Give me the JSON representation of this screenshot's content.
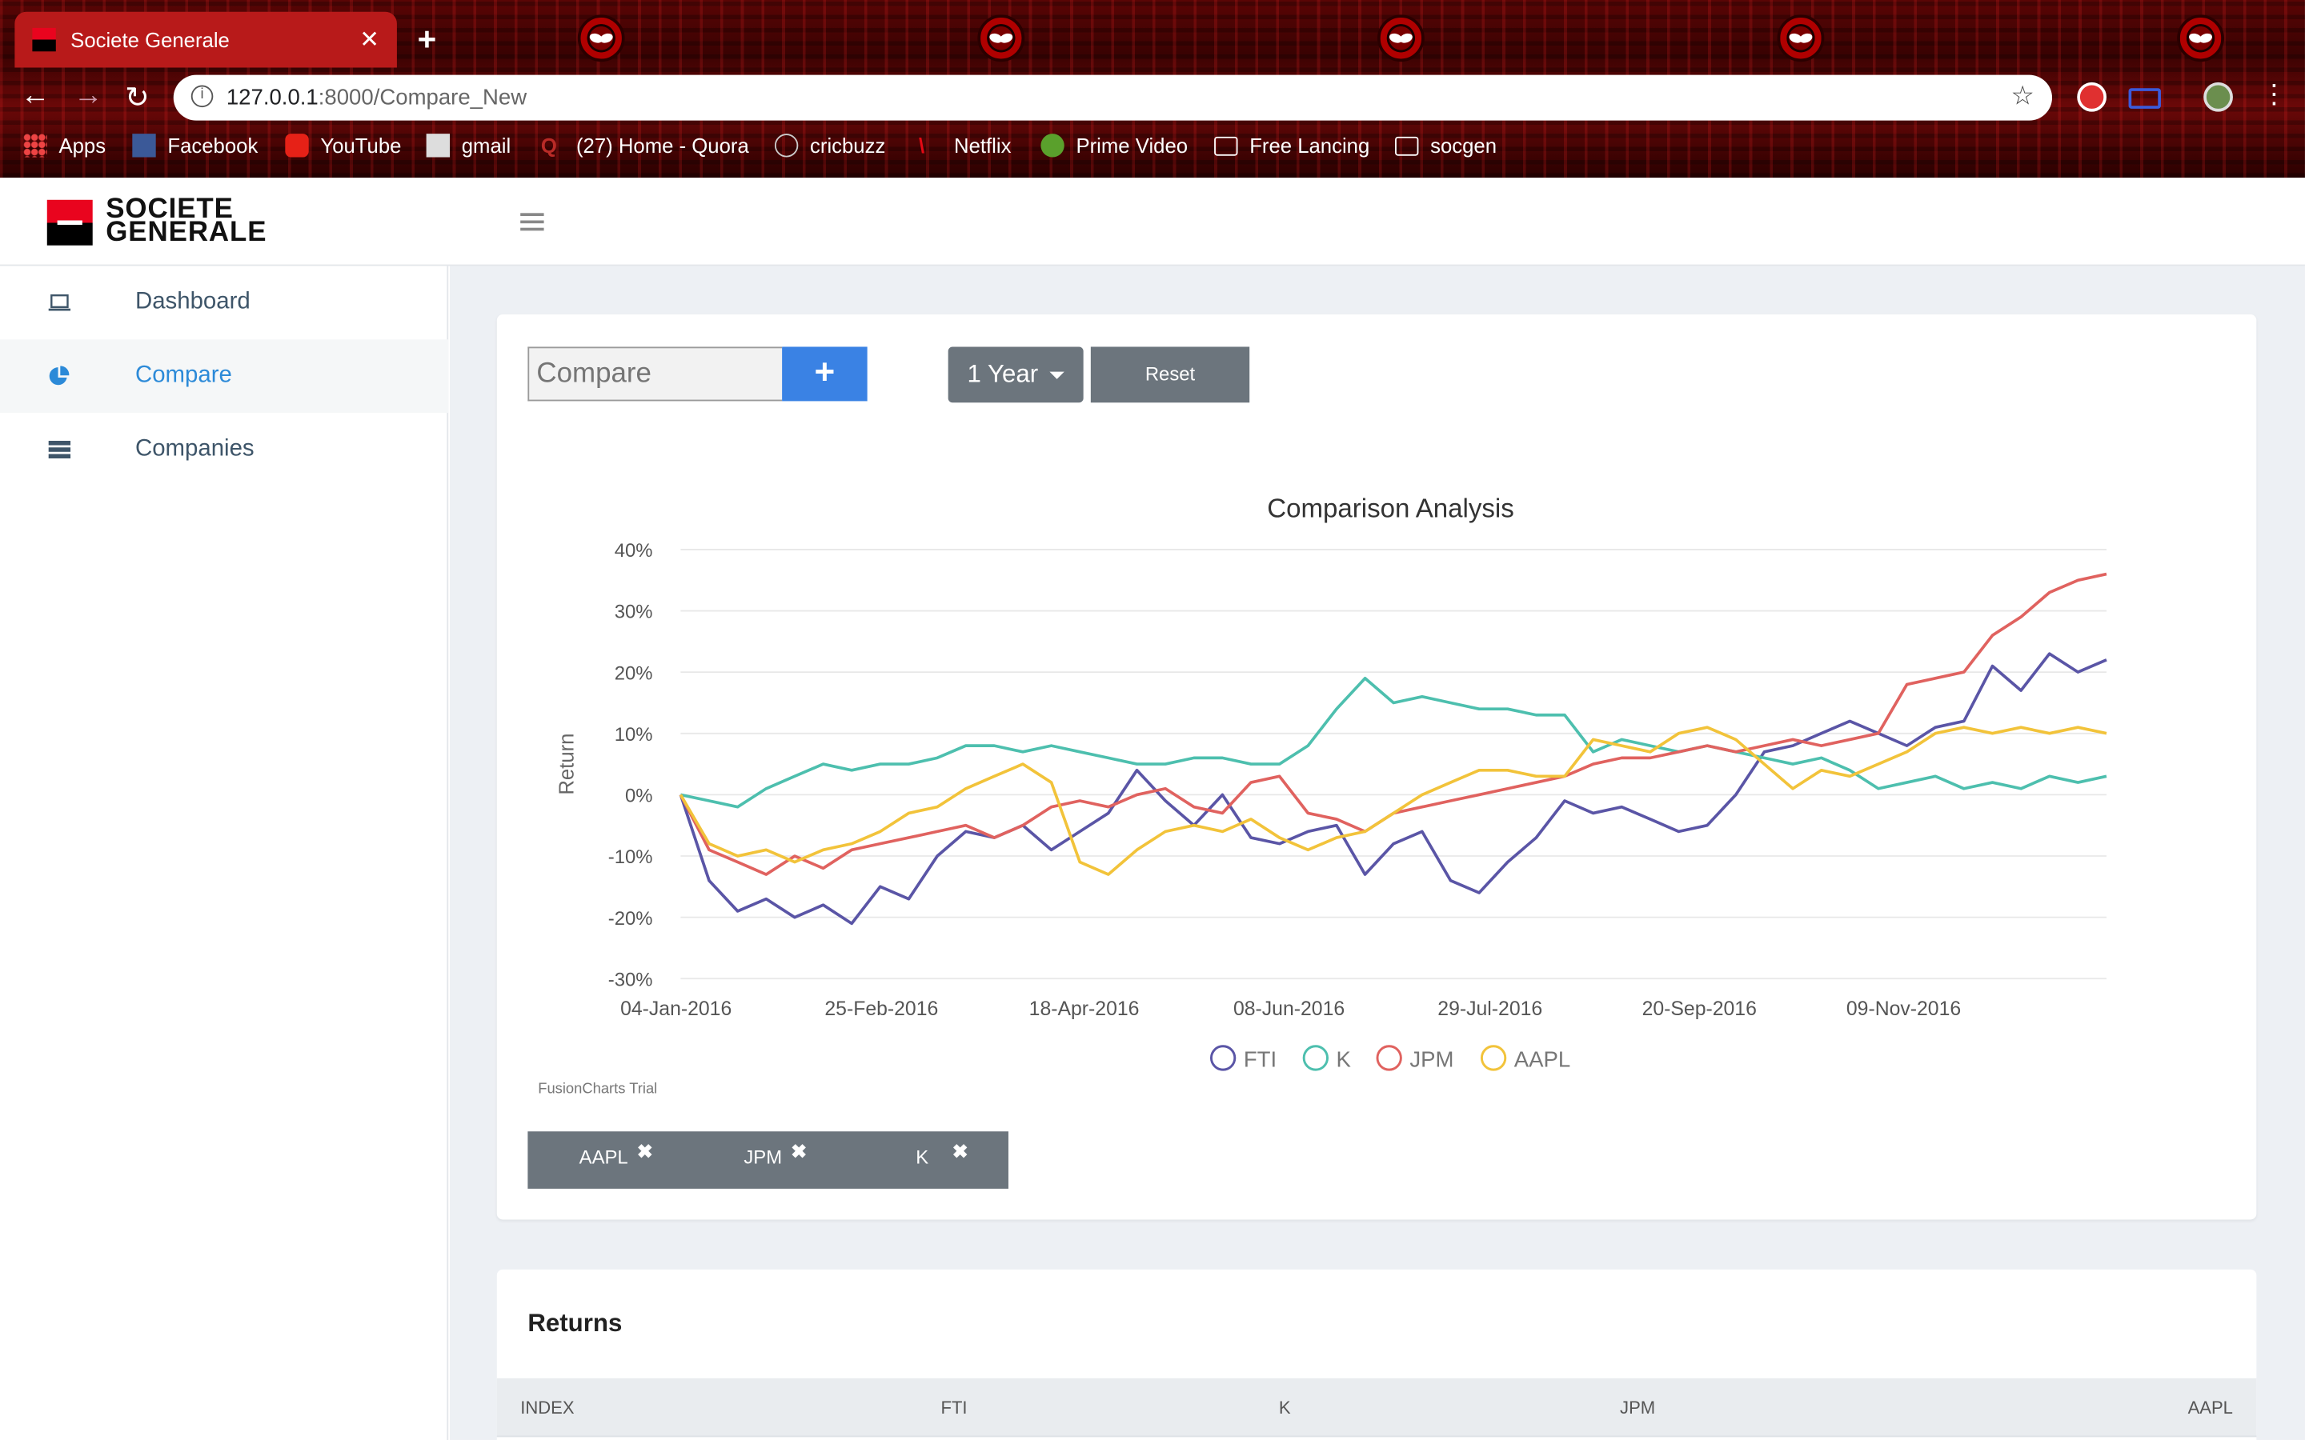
{
  "browser": {
    "tab_title": "Societe Generale",
    "url_host": "127.0.0.1",
    "url_rest": ":8000/Compare_New",
    "bookmarks": [
      "Apps",
      "Facebook",
      "YouTube",
      "gmail",
      "(27) Home - Quora",
      "cricbuzz",
      "Netflix",
      "Prime Video",
      "Free Lancing",
      "socgen"
    ]
  },
  "brand": {
    "line1": "SOCIETE",
    "line2": "GENERALE"
  },
  "sidebar": {
    "items": [
      {
        "label": "Dashboard",
        "icon": "laptop-icon"
      },
      {
        "label": "Compare",
        "icon": "pie-chart-icon"
      },
      {
        "label": "Companies",
        "icon": "server-icon"
      }
    ]
  },
  "controls": {
    "compare_placeholder": "Compare",
    "plus": "+",
    "period": "1 Year",
    "reset": "Reset"
  },
  "chips": [
    "AAPL",
    "JPM",
    "K"
  ],
  "chart_data": {
    "type": "line",
    "title": "Comparison Analysis",
    "xlabel": "",
    "ylabel": "Return",
    "ylim": [
      -30,
      40
    ],
    "yticks": [
      "40%",
      "30%",
      "20%",
      "10%",
      "0%",
      "-10%",
      "-20%",
      "-30%"
    ],
    "xtick_labels": [
      "04-Jan-2016",
      "25-Feb-2016",
      "18-Apr-2016",
      "08-Jun-2016",
      "29-Jul-2016",
      "20-Sep-2016",
      "09-Nov-2016"
    ],
    "xlim": [
      0,
      50
    ],
    "legend": "bottom-center",
    "series": [
      {
        "name": "FTI",
        "color": "#5a55a6",
        "x": [
          0,
          1,
          2,
          3,
          4,
          5,
          6,
          7,
          8,
          9,
          10,
          11,
          12,
          13,
          14,
          15,
          16,
          17,
          18,
          19,
          20,
          21,
          22,
          23,
          24,
          25,
          26,
          27,
          28,
          29,
          30,
          31,
          32,
          33,
          34,
          35,
          36,
          37,
          38,
          39,
          40,
          41,
          42,
          43,
          44,
          45,
          46,
          47,
          48,
          49,
          50
        ],
        "values": [
          0,
          -14,
          -19,
          -17,
          -20,
          -18,
          -21,
          -15,
          -17,
          -10,
          -6,
          -7,
          -5,
          -9,
          -6,
          -3,
          4,
          -1,
          -5,
          0,
          -7,
          -8,
          -6,
          -5,
          -13,
          -8,
          -6,
          -14,
          -16,
          -11,
          -7,
          -1,
          -3,
          -2,
          -4,
          -6,
          -5,
          0,
          7,
          8,
          10,
          12,
          10,
          8,
          11,
          12,
          21,
          17,
          23,
          20,
          22
        ]
      },
      {
        "name": "K",
        "color": "#4dbfae",
        "x": [
          0,
          1,
          2,
          3,
          4,
          5,
          6,
          7,
          8,
          9,
          10,
          11,
          12,
          13,
          14,
          15,
          16,
          17,
          18,
          19,
          20,
          21,
          22,
          23,
          24,
          25,
          26,
          27,
          28,
          29,
          30,
          31,
          32,
          33,
          34,
          35,
          36,
          37,
          38,
          39,
          40,
          41,
          42,
          43,
          44,
          45,
          46,
          47,
          48,
          49,
          50
        ],
        "values": [
          0,
          -1,
          -2,
          1,
          3,
          5,
          4,
          5,
          5,
          6,
          8,
          8,
          7,
          8,
          7,
          6,
          5,
          5,
          6,
          6,
          5,
          5,
          8,
          14,
          19,
          15,
          16,
          15,
          14,
          14,
          13,
          13,
          7,
          9,
          8,
          7,
          8,
          7,
          6,
          5,
          6,
          4,
          1,
          2,
          3,
          1,
          2,
          1,
          3,
          2,
          3
        ]
      },
      {
        "name": "JPM",
        "color": "#e0625f",
        "x": [
          0,
          1,
          2,
          3,
          4,
          5,
          6,
          7,
          8,
          9,
          10,
          11,
          12,
          13,
          14,
          15,
          16,
          17,
          18,
          19,
          20,
          21,
          22,
          23,
          24,
          25,
          26,
          27,
          28,
          29,
          30,
          31,
          32,
          33,
          34,
          35,
          36,
          37,
          38,
          39,
          40,
          41,
          42,
          43,
          44,
          45,
          46,
          47,
          48,
          49,
          50
        ],
        "values": [
          0,
          -9,
          -11,
          -13,
          -10,
          -12,
          -9,
          -8,
          -7,
          -6,
          -5,
          -7,
          -5,
          -2,
          -1,
          -2,
          0,
          1,
          -2,
          -3,
          2,
          3,
          -3,
          -4,
          -6,
          -3,
          -2,
          -1,
          0,
          1,
          2,
          3,
          5,
          6,
          6,
          7,
          8,
          7,
          8,
          9,
          8,
          9,
          10,
          18,
          19,
          20,
          26,
          29,
          33,
          35,
          36
        ]
      },
      {
        "name": "AAPL",
        "color": "#f2c33a",
        "x": [
          0,
          1,
          2,
          3,
          4,
          5,
          6,
          7,
          8,
          9,
          10,
          11,
          12,
          13,
          14,
          15,
          16,
          17,
          18,
          19,
          20,
          21,
          22,
          23,
          24,
          25,
          26,
          27,
          28,
          29,
          30,
          31,
          32,
          33,
          34,
          35,
          36,
          37,
          38,
          39,
          40,
          41,
          42,
          43,
          44,
          45,
          46,
          47,
          48,
          49,
          50
        ],
        "values": [
          0,
          -8,
          -10,
          -9,
          -11,
          -9,
          -8,
          -6,
          -3,
          -2,
          1,
          3,
          5,
          2,
          -11,
          -13,
          -9,
          -6,
          -5,
          -6,
          -4,
          -7,
          -9,
          -7,
          -6,
          -3,
          0,
          2,
          4,
          4,
          3,
          3,
          9,
          8,
          7,
          10,
          11,
          9,
          5,
          1,
          4,
          3,
          5,
          7,
          10,
          11,
          10,
          11,
          10,
          11,
          10
        ]
      }
    ]
  },
  "returns": {
    "title": "Returns",
    "headers": [
      "INDEX",
      "FTI",
      "K",
      "JPM",
      "AAPL"
    ]
  }
}
